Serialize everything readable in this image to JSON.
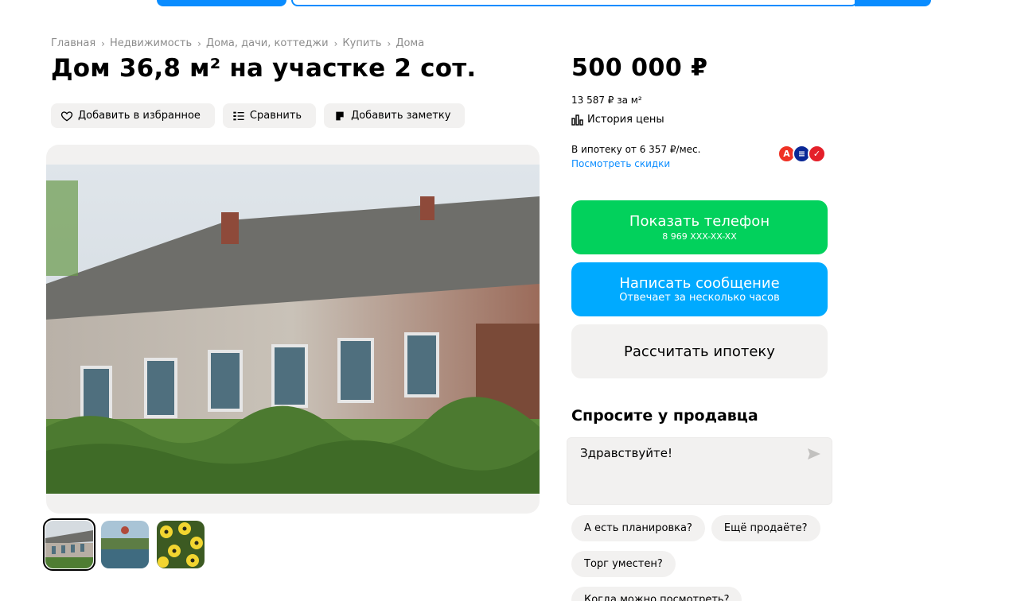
{
  "breadcrumbs": [
    "Главная",
    "Недвижимость",
    "Дома, дачи, коттеджи",
    "Купить",
    "Дома"
  ],
  "title": "Дом 36,8 м² на участке 2 сот.",
  "actions": {
    "favorite": "Добавить в избранное",
    "compare": "Сравнить",
    "note": "Добавить заметку"
  },
  "gallery": {
    "thumbnails": [
      "house-photo",
      "river-photo",
      "flowers-photo"
    ],
    "active_index": 0
  },
  "price": {
    "total": "500 000 ₽",
    "per_m2": "13 587 ₽ за м²",
    "history_label": "История цены"
  },
  "mortgage": {
    "text": "В ипотеку от 6 357 ₽/мес.",
    "discounts_link": "Посмотреть скидки",
    "banks": [
      {
        "name": "alfa-bank-logo",
        "color": "#ef3124",
        "glyph": "А"
      },
      {
        "name": "vtb-logo",
        "color": "#0a2896",
        "glyph": "≡"
      },
      {
        "name": "sovcombank-logo",
        "color": "#e4202a",
        "glyph": "✓"
      }
    ]
  },
  "contact": {
    "phone_label": "Показать телефон",
    "phone_masked": "8 969 XXX-XX-XX",
    "message_label": "Написать сообщение",
    "message_sub": "Отвечает за несколько часов",
    "mortgage_calc_label": "Рассчитать ипотеку"
  },
  "ask_seller": {
    "title": "Спросите у продавца",
    "message": "Здравствуйте!",
    "chips": [
      "А есть планировка?",
      "Ещё продаёте?",
      "Торг уместен?",
      "Когда можно посмотреть?"
    ]
  },
  "colors": {
    "accent_blue": "#0a8cff",
    "phone_green": "#02d15c",
    "message_blue": "#00aaff",
    "neutral_bg": "#f2f1f0"
  }
}
